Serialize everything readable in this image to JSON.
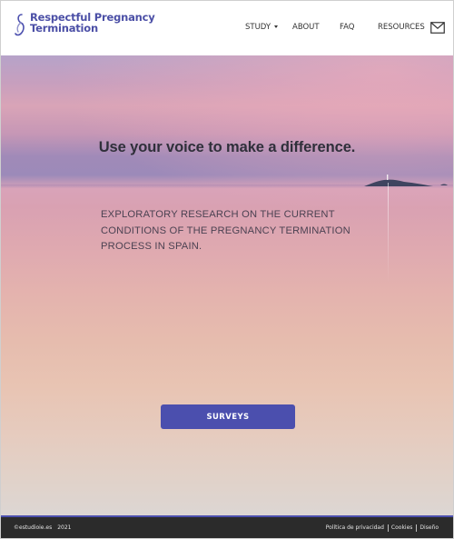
{
  "header": {
    "logo_line1": "Respectful Pregnancy",
    "logo_line2": "Termination",
    "logo_icon": "ribbon-icon",
    "nav": {
      "study": "STUDY",
      "about": "ABOUT",
      "faq": "FAQ",
      "resources": "RESOURCES"
    },
    "mail_icon": "mail-icon"
  },
  "hero": {
    "title": "Use your voice to make a difference.",
    "subtitle": "EXPLORATORY RESEARCH ON THE CURRENT CONDITIONS OF THE PREGNANCY TERMINATION PROCESS IN SPAIN.",
    "button_label": "SURVEYS"
  },
  "footer": {
    "credit": "©estudioie.es",
    "year": "2021",
    "links": {
      "privacy": "Política de privacidad",
      "cookies": "Cookies",
      "design": "Diseño"
    }
  },
  "colors": {
    "brand": "#4b4fae",
    "footer_bg": "#2b2b2b"
  }
}
